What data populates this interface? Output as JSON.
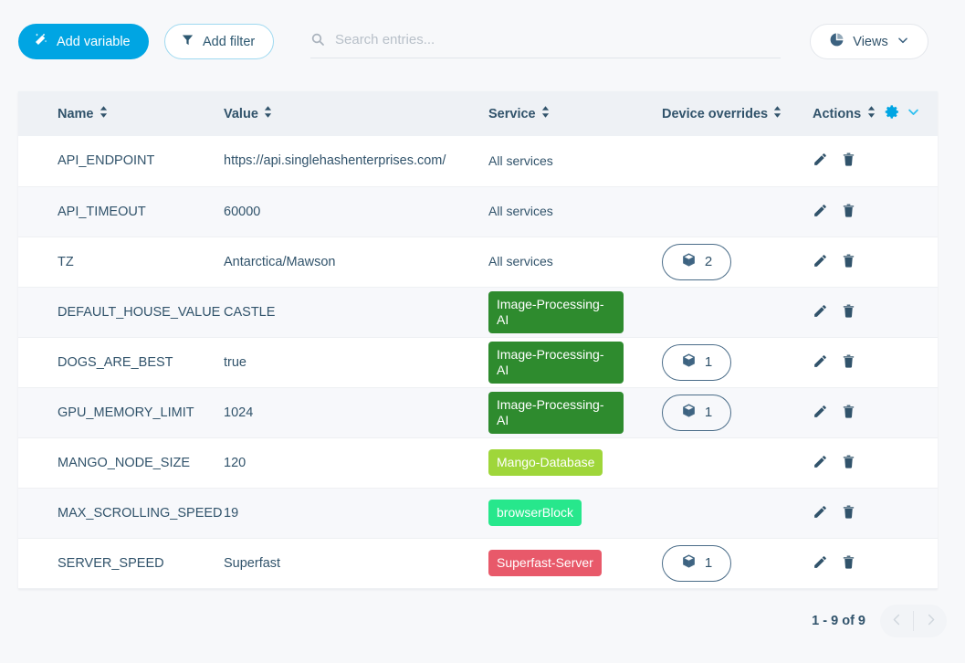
{
  "toolbar": {
    "add_variable_label": "Add variable",
    "add_variable_icon": "magic-wand-icon",
    "add_variable_color": "#00a5e3",
    "add_filter_label": "Add filter",
    "add_filter_icon": "funnel-icon",
    "search_placeholder": "Search entries...",
    "search_value": "",
    "search_icon": "search-icon",
    "views_label": "Views",
    "views_icon": "pie-chart-icon",
    "views_chevron": "chevron-down-icon"
  },
  "table": {
    "columns": [
      {
        "label": "Name",
        "sortable": true
      },
      {
        "label": "Value",
        "sortable": true
      },
      {
        "label": "Service",
        "sortable": true
      },
      {
        "label": "Device overrides",
        "sortable": true
      },
      {
        "label": "Actions",
        "sortable": true
      }
    ],
    "header_gear_icon": "gear-icon",
    "header_chevron_icon": "chevron-down-icon",
    "header_gear_color": "#00a5e3",
    "rows": [
      {
        "name": "API_ENDPOINT",
        "value": "https://api.singlehashenterprises.com/",
        "service": "All services",
        "service_color": "",
        "service_badge": false,
        "device_overrides": "",
        "edit_icon": "pencil-icon",
        "delete_icon": "trash-icon"
      },
      {
        "name": "API_TIMEOUT",
        "value": "60000",
        "service": "All services",
        "service_color": "",
        "service_badge": false,
        "device_overrides": "",
        "edit_icon": "pencil-icon",
        "delete_icon": "trash-icon"
      },
      {
        "name": "TZ",
        "value": "Antarctica/Mawson",
        "service": "All services",
        "service_color": "",
        "service_badge": false,
        "device_overrides": "2",
        "edit_icon": "pencil-icon",
        "delete_icon": "trash-icon"
      },
      {
        "name": "DEFAULT_HOUSE_VALUE",
        "value": "CASTLE",
        "service": "Image-Processing-AI",
        "service_color": "#2e8b2e",
        "service_badge": true,
        "device_overrides": "",
        "edit_icon": "pencil-icon",
        "delete_icon": "trash-icon"
      },
      {
        "name": "DOGS_ARE_BEST",
        "value": "true",
        "service": "Image-Processing-AI",
        "service_color": "#2e8b2e",
        "service_badge": true,
        "device_overrides": "1",
        "edit_icon": "pencil-icon",
        "delete_icon": "trash-icon"
      },
      {
        "name": "GPU_MEMORY_LIMIT",
        "value": "1024",
        "service": "Image-Processing-AI",
        "service_color": "#2e8b2e",
        "service_badge": true,
        "device_overrides": "1",
        "edit_icon": "pencil-icon",
        "delete_icon": "trash-icon"
      },
      {
        "name": "MANGO_NODE_SIZE",
        "value": "120",
        "service": "Mango-Database",
        "service_color": "#9fd63a",
        "service_badge": true,
        "device_overrides": "",
        "edit_icon": "pencil-icon",
        "delete_icon": "trash-icon"
      },
      {
        "name": "MAX_SCROLLING_SPEED",
        "value": "19",
        "service": "browserBlock",
        "service_color": "#27e78c",
        "service_badge": true,
        "device_overrides": "",
        "edit_icon": "pencil-icon",
        "delete_icon": "trash-icon"
      },
      {
        "name": "SERVER_SPEED",
        "value": "Superfast",
        "service": "Superfast-Server",
        "service_color": "#e8596a",
        "service_badge": true,
        "device_overrides": "1",
        "edit_icon": "pencil-icon",
        "delete_icon": "trash-icon"
      }
    ]
  },
  "footer": {
    "range_label": "1 - 9 of 9",
    "prev_icon": "chevron-left-icon",
    "next_icon": "chevron-right-icon"
  }
}
